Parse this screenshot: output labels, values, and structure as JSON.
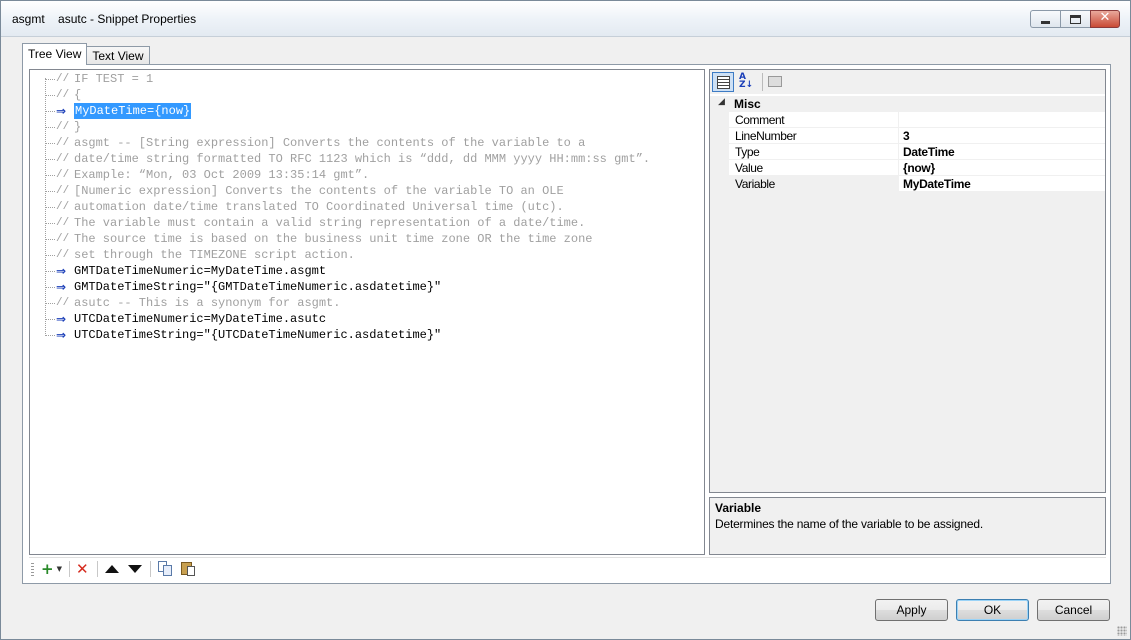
{
  "window": {
    "title": "asgmt    asutc - Snippet Properties",
    "minimize_icon": "minimize-icon",
    "maximize_icon": "restore-icon",
    "close_icon": "close-icon"
  },
  "tabs": [
    {
      "label": "Tree View",
      "active": true
    },
    {
      "label": "Text View",
      "active": false
    }
  ],
  "tree": {
    "rows": [
      {
        "kind": "comment",
        "icon": "//",
        "text": "IF TEST = 1"
      },
      {
        "kind": "comment",
        "icon": "//",
        "text": "{"
      },
      {
        "kind": "code",
        "icon": "⇒",
        "text": "MyDateTime={now}",
        "selected": true
      },
      {
        "kind": "comment",
        "icon": "//",
        "text": "}"
      },
      {
        "kind": "comment",
        "icon": "//",
        "text": "asgmt -- [String expression] Converts the contents of the variable to a"
      },
      {
        "kind": "comment",
        "icon": "//",
        "text": "date/time string formatted TO RFC 1123 which is “ddd, dd MMM yyyy HH:mm:ss gmt”."
      },
      {
        "kind": "comment",
        "icon": "//",
        "text": "Example: “Mon, 03 Oct 2009 13:35:14 gmt”."
      },
      {
        "kind": "comment",
        "icon": "//",
        "text": "[Numeric expression] Converts the contents of the variable TO an OLE"
      },
      {
        "kind": "comment",
        "icon": "//",
        "text": "automation date/time translated TO Coordinated Universal time (utc)."
      },
      {
        "kind": "comment",
        "icon": "//",
        "text": "The variable must contain a valid string representation of a date/time."
      },
      {
        "kind": "comment",
        "icon": "//",
        "text": "The source time is based on the business unit time zone OR the time zone"
      },
      {
        "kind": "comment",
        "icon": "//",
        "text": "set through the TIMEZONE script action."
      },
      {
        "kind": "code",
        "icon": "⇒",
        "text": "GMTDateTimeNumeric=MyDateTime.asgmt"
      },
      {
        "kind": "code",
        "icon": "⇒",
        "text": "GMTDateTimeString=\"{GMTDateTimeNumeric.asdatetime}\""
      },
      {
        "kind": "comment",
        "icon": "//",
        "text": "asutc -- This is a synonym for asgmt."
      },
      {
        "kind": "code",
        "icon": "⇒",
        "text": "UTCDateTimeNumeric=MyDateTime.asutc"
      },
      {
        "kind": "code",
        "icon": "⇒",
        "text": "UTCDateTimeString=\"{UTCDateTimeNumeric.asdatetime}\""
      }
    ]
  },
  "properties": {
    "category": "Misc",
    "category_arrow": "◢",
    "rows": [
      {
        "name": "Comment",
        "value": ""
      },
      {
        "name": "LineNumber",
        "value": "3"
      },
      {
        "name": "Type",
        "value": "DateTime"
      },
      {
        "name": "Value",
        "value": "{now}"
      },
      {
        "name": "Variable",
        "value": "MyDateTime",
        "selected": true
      }
    ],
    "toolbar": {
      "categorized_icon": "categorized-icon",
      "alphabetical_icon": "sort-alphabetical-icon",
      "alphabetical_glyph": "A\nZ↓",
      "property_pages_icon": "property-pages-icon"
    }
  },
  "help": {
    "title": "Variable",
    "description": "Determines the name of the variable to be assigned."
  },
  "edit_toolbar": {
    "add_glyph": "+",
    "dropdown_glyph": "▼",
    "delete_glyph": "✕"
  },
  "buttons": {
    "apply": "Apply",
    "ok": "OK",
    "cancel": "Cancel"
  },
  "colors": {
    "selection": "#3399ff",
    "comment_text": "#a0a0a0",
    "arrow_icon": "#1b3fb8"
  }
}
